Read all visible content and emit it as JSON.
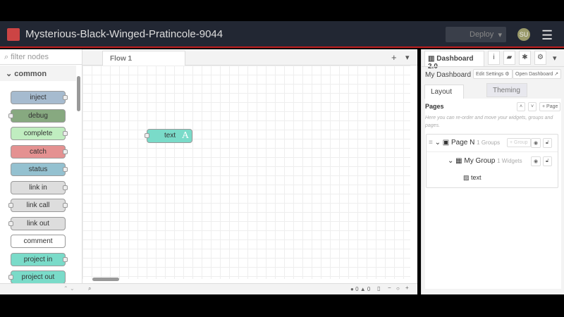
{
  "header": {
    "title": "Mysterious-Black-Winged-Pratincole-9044",
    "deploy_label": "Deploy",
    "avatar": "SU",
    "menu_icon": "hamburger-icon"
  },
  "palette": {
    "filter_placeholder": "filter nodes",
    "category": "common",
    "nodes": [
      {
        "label": "inject",
        "color": "#a6bbcf"
      },
      {
        "label": "debug",
        "color": "#87a980"
      },
      {
        "label": "complete",
        "color": "#c0edc0"
      },
      {
        "label": "catch",
        "color": "#e49191"
      },
      {
        "label": "status",
        "color": "#94c1d0"
      },
      {
        "label": "link in",
        "color": "#dddddd"
      },
      {
        "label": "link call",
        "color": "#dddddd"
      },
      {
        "label": "link out",
        "color": "#dddddd"
      },
      {
        "label": "comment",
        "color": "#ffffff"
      },
      {
        "label": "project in",
        "color": "#7adbc9"
      },
      {
        "label": "project out",
        "color": "#7adbc9"
      }
    ]
  },
  "workspace": {
    "tab": "Flow 1",
    "node_label": "text",
    "errors": "0",
    "warnings": "0"
  },
  "sidebar": {
    "tab": "Dashboard 2.0",
    "title": "My Dashboard",
    "edit_settings": "Edit Settings",
    "open_dashboard": "Open Dashboard",
    "tabs": [
      "Layout",
      "Theming"
    ],
    "pages_heading": "Pages",
    "add_page": "+ Page",
    "help": "Here you can re-order and move your widgets, groups and pages.",
    "page": {
      "name": "Page N",
      "count": "1 Groups",
      "add_group": "+ Group"
    },
    "group": {
      "name": "My Group",
      "count": "1 Widgets"
    },
    "widget": "text"
  }
}
